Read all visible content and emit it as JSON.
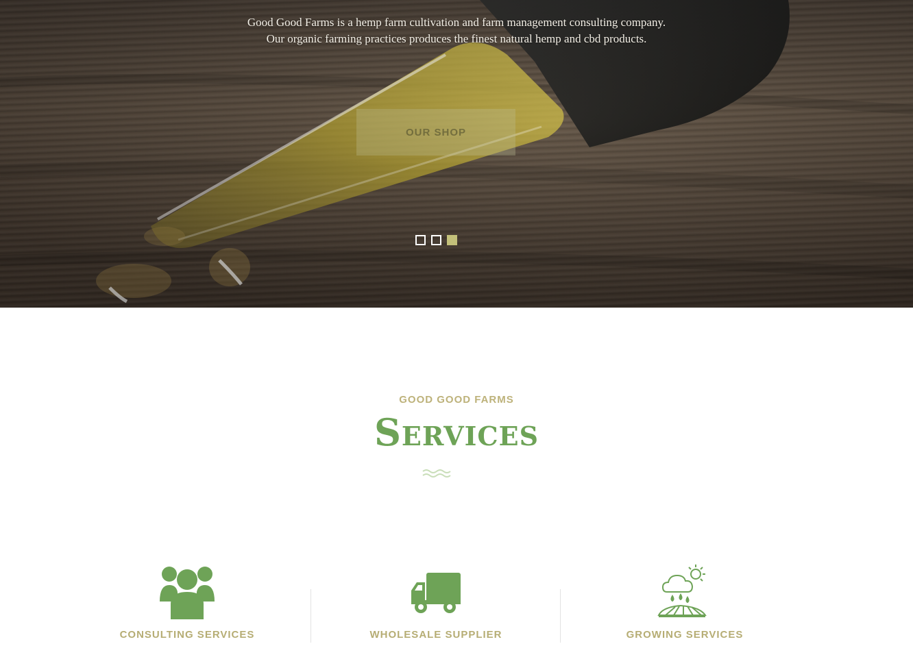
{
  "hero": {
    "line1": "Good Good Farms is a hemp farm cultivation and farm management consulting company.",
    "line2": "Our organic farming practices produces the finest natural hemp and cbd products.",
    "button_label": "OUR SHOP",
    "slides": 3,
    "active_slide": 3
  },
  "services": {
    "eyebrow": "GOOD GOOD FARMS",
    "title": "Services",
    "items": [
      {
        "label": "CONSULTING SERVICES",
        "icon": "users-group-icon"
      },
      {
        "label": "WHOLESALE SUPPLIER",
        "icon": "delivery-truck-icon"
      },
      {
        "label": "GROWING SERVICES",
        "icon": "cloud-rain-field-icon"
      }
    ]
  },
  "colors": {
    "accent_green": "#6ea357",
    "accent_olive": "#bdb27a",
    "dot_active": "#c3c07a"
  }
}
